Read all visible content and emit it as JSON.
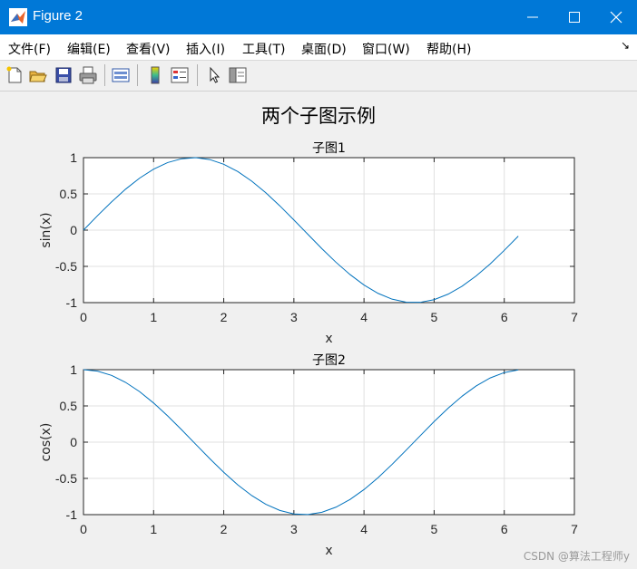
{
  "window": {
    "title": "Figure 2"
  },
  "menu": [
    "文件(F)",
    "编辑(E)",
    "查看(V)",
    "插入(I)",
    "工具(T)",
    "桌面(D)",
    "窗口(W)",
    "帮助(H)"
  ],
  "toolbar_icons": [
    "new-file-icon",
    "open-folder-icon",
    "save-icon",
    "print-icon",
    "link-plot-icon",
    "colorbar-icon",
    "legend-icon",
    "pointer-icon",
    "property-inspector-icon"
  ],
  "figure": {
    "suptitle": "两个子图示例"
  },
  "chart_data": [
    {
      "type": "line",
      "title": "子图1",
      "xlabel": "x",
      "ylabel": "sin(x)",
      "xlim": [
        0,
        7
      ],
      "ylim": [
        -1,
        1
      ],
      "xticks": [
        0,
        1,
        2,
        3,
        4,
        5,
        6,
        7
      ],
      "yticks": [
        1,
        0.5,
        0,
        -0.5,
        -1
      ],
      "grid": true,
      "series": [
        {
          "color": "#0072bd",
          "x": [
            0,
            0.2,
            0.4,
            0.6,
            0.8,
            1.0,
            1.2,
            1.4,
            1.6,
            1.8,
            2.0,
            2.2,
            2.4,
            2.6,
            2.8,
            3.0,
            3.2,
            3.4,
            3.6,
            3.8,
            4.0,
            4.2,
            4.4,
            4.6,
            4.8,
            5.0,
            5.2,
            5.4,
            5.6,
            5.8,
            6.0,
            6.2
          ],
          "y": [
            0,
            0.199,
            0.389,
            0.565,
            0.717,
            0.841,
            0.932,
            0.985,
            1.0,
            0.974,
            0.909,
            0.808,
            0.675,
            0.516,
            0.335,
            0.141,
            -0.058,
            -0.256,
            -0.443,
            -0.612,
            -0.757,
            -0.872,
            -0.952,
            -0.994,
            -0.996,
            -0.959,
            -0.883,
            -0.773,
            -0.631,
            -0.465,
            -0.279,
            -0.083
          ]
        }
      ]
    },
    {
      "type": "line",
      "title": "子图2",
      "xlabel": "x",
      "ylabel": "cos(x)",
      "xlim": [
        0,
        7
      ],
      "ylim": [
        -1,
        1
      ],
      "xticks": [
        0,
        1,
        2,
        3,
        4,
        5,
        6,
        7
      ],
      "yticks": [
        1,
        0.5,
        0,
        -0.5,
        -1
      ],
      "grid": true,
      "series": [
        {
          "color": "#0072bd",
          "x": [
            0,
            0.2,
            0.4,
            0.6,
            0.8,
            1.0,
            1.2,
            1.4,
            1.6,
            1.8,
            2.0,
            2.2,
            2.4,
            2.6,
            2.8,
            3.0,
            3.2,
            3.4,
            3.6,
            3.8,
            4.0,
            4.2,
            4.4,
            4.6,
            4.8,
            5.0,
            5.2,
            5.4,
            5.6,
            5.8,
            6.0,
            6.2
          ],
          "y": [
            1.0,
            0.98,
            0.921,
            0.825,
            0.697,
            0.54,
            0.362,
            0.17,
            -0.029,
            -0.227,
            -0.416,
            -0.589,
            -0.737,
            -0.857,
            -0.942,
            -0.99,
            -0.998,
            -0.967,
            -0.897,
            -0.791,
            -0.654,
            -0.49,
            -0.307,
            -0.112,
            0.087,
            0.284,
            0.469,
            0.635,
            0.776,
            0.886,
            0.96,
            0.997
          ]
        }
      ]
    }
  ],
  "watermark": "CSDN @算法工程师y"
}
